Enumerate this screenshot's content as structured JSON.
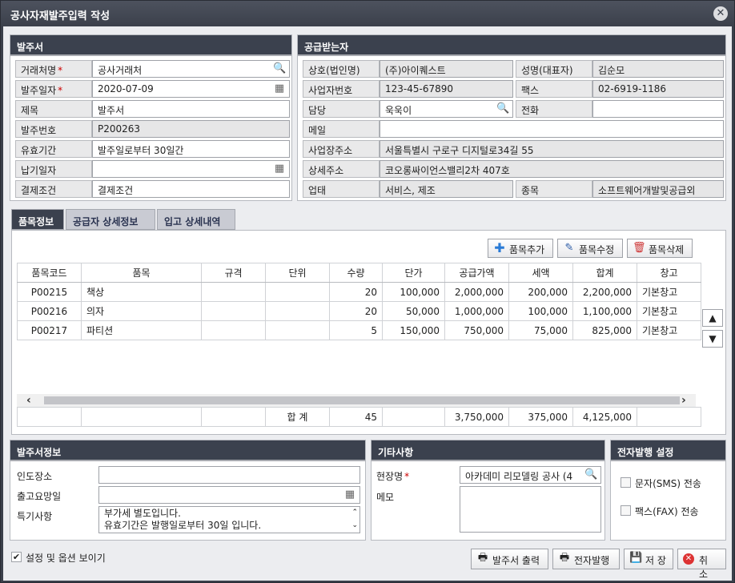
{
  "window": {
    "title": "공사자재발주입력 작성"
  },
  "order": {
    "header": "발주서",
    "fields": [
      {
        "label": "거래처명",
        "required": true,
        "value": "공사거래처",
        "icon": "search-icon"
      },
      {
        "label": "발주일자",
        "required": true,
        "value": "2020-07-09",
        "icon": "calendar-icon"
      },
      {
        "label": "제목",
        "required": false,
        "value": "발주서"
      },
      {
        "label": "발주번호",
        "required": false,
        "value": "P200263"
      },
      {
        "label": "유효기간",
        "required": false,
        "value": "발주일로부터 30일간"
      },
      {
        "label": "납기일자",
        "required": false,
        "value": "",
        "icon": "calendar-icon"
      },
      {
        "label": "결제조건",
        "required": false,
        "value": "결제조건"
      }
    ]
  },
  "supplier": {
    "header": "공급받는자",
    "company_label": "상호(법인명)",
    "company_value": "(주)아이퀘스트",
    "ceo_label": "성명(대표자)",
    "ceo_value": "김순모",
    "bizno_label": "사업자번호",
    "bizno_value": "123-45-67890",
    "fax_label": "팩스",
    "fax_value": "02-6919-1186",
    "manager_label": "담당",
    "manager_value": "욱욱이",
    "phone_label": "전화",
    "phone_value": "",
    "email_label": "메일",
    "email_value": "",
    "address_label": "사업장주소",
    "address_value": "서울특별시 구로구 디지털로34길 55",
    "address2_label": "상세주소",
    "address2_value": "코오롱싸이언스밸리2차 407호",
    "biztype_label": "업태",
    "biztype_value": "서비스, 제조",
    "bizitem_label": "종목",
    "bizitem_value": "소프트웨어개발및공급외"
  },
  "tabs": [
    "품목정보",
    "공급자 상세정보",
    "입고 상세내역"
  ],
  "grid": {
    "buttons": {
      "add": "품목추가",
      "edit": "품목수정",
      "delete": "품목삭제"
    },
    "columns": [
      "품목코드",
      "품목",
      "규격",
      "단위",
      "수량",
      "단가",
      "공급가액",
      "세액",
      "합계",
      "창고"
    ],
    "rows": [
      [
        "P00215",
        "책상",
        "",
        "",
        "20",
        "100,000",
        "2,000,000",
        "200,000",
        "2,200,000",
        "기본창고"
      ],
      [
        "P00216",
        "의자",
        "",
        "",
        "20",
        "50,000",
        "1,000,000",
        "100,000",
        "1,100,000",
        "기본창고"
      ],
      [
        "P00217",
        "파티션",
        "",
        "",
        "5",
        "150,000",
        "750,000",
        "75,000",
        "825,000",
        "기본창고"
      ]
    ],
    "total": {
      "label": "합 계",
      "qty": "45",
      "supply": "3,750,000",
      "tax": "375,000",
      "sum": "4,125,000"
    }
  },
  "order_info": {
    "header": "발주서정보",
    "delivery_label": "인도장소",
    "delivery_value": "",
    "ship_label": "출고요망일",
    "ship_value": "",
    "notes_label": "특기사항",
    "notes_line1": "부가세 별도입니다.",
    "notes_line2": "유효기간은 발행일로부터 30일 입니다."
  },
  "etc": {
    "header": "기타사항",
    "site_label": "현장명",
    "site_value": "아카데미 리모델링 공사 (4",
    "memo_label": "메모",
    "memo_value": ""
  },
  "electronic": {
    "header": "전자발행 설정",
    "sms": "문자(SMS) 전송",
    "fax": "팩스(FAX) 전송"
  },
  "footer": {
    "show_options": "설정 및 옵션 보이기",
    "print": "발주서 출력",
    "issue": "전자발행",
    "save": "저 장",
    "cancel": "취 소"
  }
}
